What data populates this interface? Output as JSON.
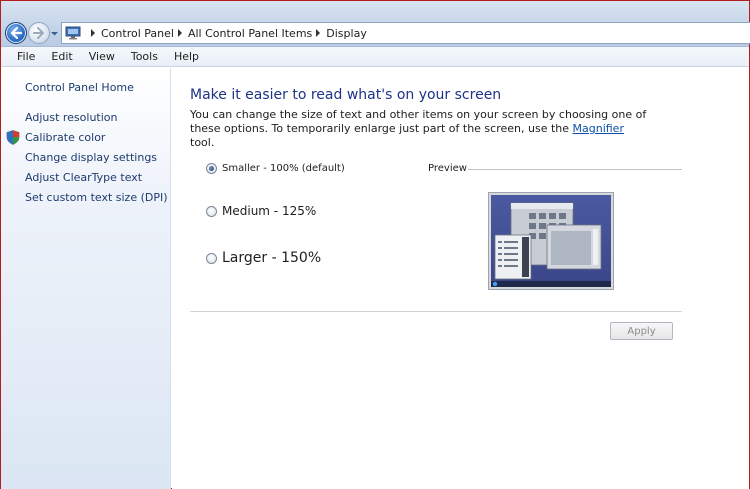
{
  "breadcrumbs": [
    "Control Panel",
    "All Control Panel Items",
    "Display"
  ],
  "menu": [
    "File",
    "Edit",
    "View",
    "Tools",
    "Help"
  ],
  "sidebar": {
    "home": "Control Panel Home",
    "links": [
      "Adjust resolution",
      "Calibrate color",
      "Change display settings",
      "Adjust ClearType text",
      "Set custom text size (DPI)"
    ]
  },
  "main": {
    "heading": "Make it easier to read what's on your screen",
    "desc_before": "You can change the size of text and other items on your screen by choosing one of these options. To temporarily enlarge just part of the screen, use the ",
    "desc_link": "Magnifier",
    "desc_after": " tool.",
    "options": [
      {
        "label": "Smaller - 100% (default)",
        "selected": true
      },
      {
        "label": "Medium - 125%",
        "selected": false
      },
      {
        "label": "Larger - 150%",
        "selected": false
      }
    ],
    "preview_label": "Preview",
    "apply_label": "Apply"
  },
  "icons": {
    "back": "back-arrow-icon",
    "forward": "forward-arrow-icon",
    "address": "control-panel-icon",
    "shield": "uac-shield-icon"
  }
}
